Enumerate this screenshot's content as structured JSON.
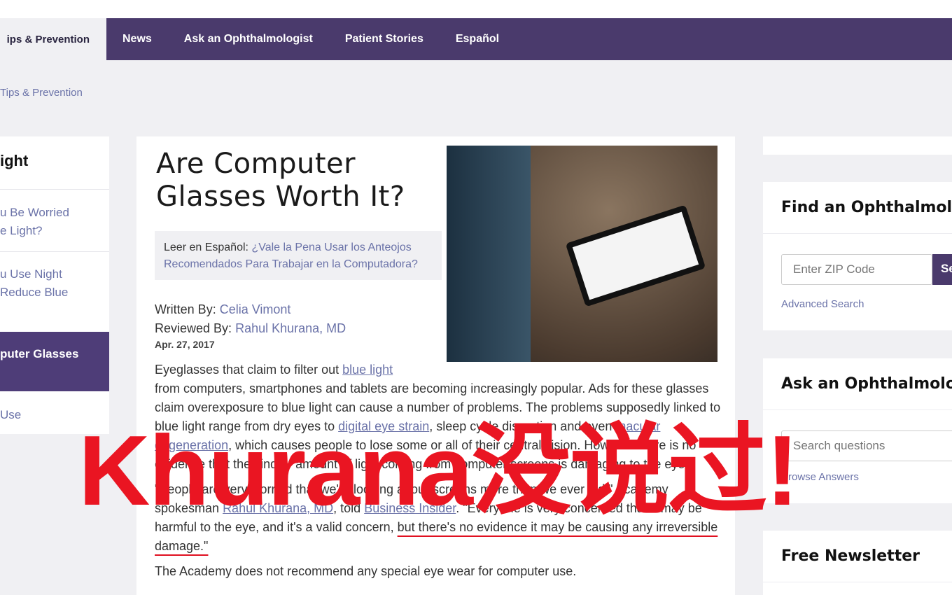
{
  "nav": {
    "items": [
      "ips & Prevention",
      "News",
      "Ask an Ophthalmologist",
      "Patient Stories",
      "Español"
    ]
  },
  "breadcrumb": "Tips & Prevention",
  "sidebar": {
    "heading": "ight",
    "items": [
      "u Be Worried\ne Light?",
      "u Use Night\nReduce Blue",
      "puter Glasses",
      "Use"
    ]
  },
  "article": {
    "title": "Are Computer Glasses Worth It?",
    "spanish_label": "Leer en Español:",
    "spanish_link": "¿Vale la Pena Usar los Anteojos Recomendados Para Trabajar en la Computadora?",
    "written_label": "Written By:",
    "author": "Celia Vimont",
    "reviewed_label": "Reviewed By:",
    "reviewer": "Rahul Khurana, MD",
    "date": "Apr. 27, 2017",
    "p1a": "Eyeglasses that claim to filter out ",
    "p1link1": "blue light",
    "p1b": " from computers, smartphones and tablets are becoming increasingly popular. Ads for these glasses claim overexposure to blue light can cause a number of problems. The problems supposedly linked to blue light range from dry eyes to ",
    "p1link2": "digital eye strain",
    "p1c": ", sleep cycle disruption and even ",
    "p1link3": "macular degeneration",
    "p1d": ", which causes people to lose some or all of their central vision. However there is no evidence that the kind or amount of light coming from computer screens is damaging to the eyes.",
    "p2a": "\"People are very worried that we're looking at our screens more than we ever did,\" Academy spokesman ",
    "p2link1": "Rahul Khurana, MD",
    "p2b": ", told ",
    "p2link2": "Business Insider",
    "p2c": ". \"Everyone is very concerned that it may be harmful to the eye, and it's a valid concern, ",
    "p2u": "but there's no evidence it may be causing any irreversible damage.\"",
    "p3": "The Academy does not recommend any special eye wear for computer use."
  },
  "right": {
    "find_title": "Find an Ophthalmologist",
    "zip_placeholder": "Enter ZIP Code",
    "search_btn": "Search",
    "advanced": "Advanced Search",
    "ask_title": "Ask an Ophthalmologist",
    "questions_placeholder": "Search questions",
    "browse": "Browse Answers",
    "newsletter_title": "Free Newsletter"
  },
  "overlay_caption": "Khurana没说过!",
  "colors": {
    "nav": "#4a3a6c",
    "link": "#6a72a8",
    "overlay": "#ea1522"
  }
}
